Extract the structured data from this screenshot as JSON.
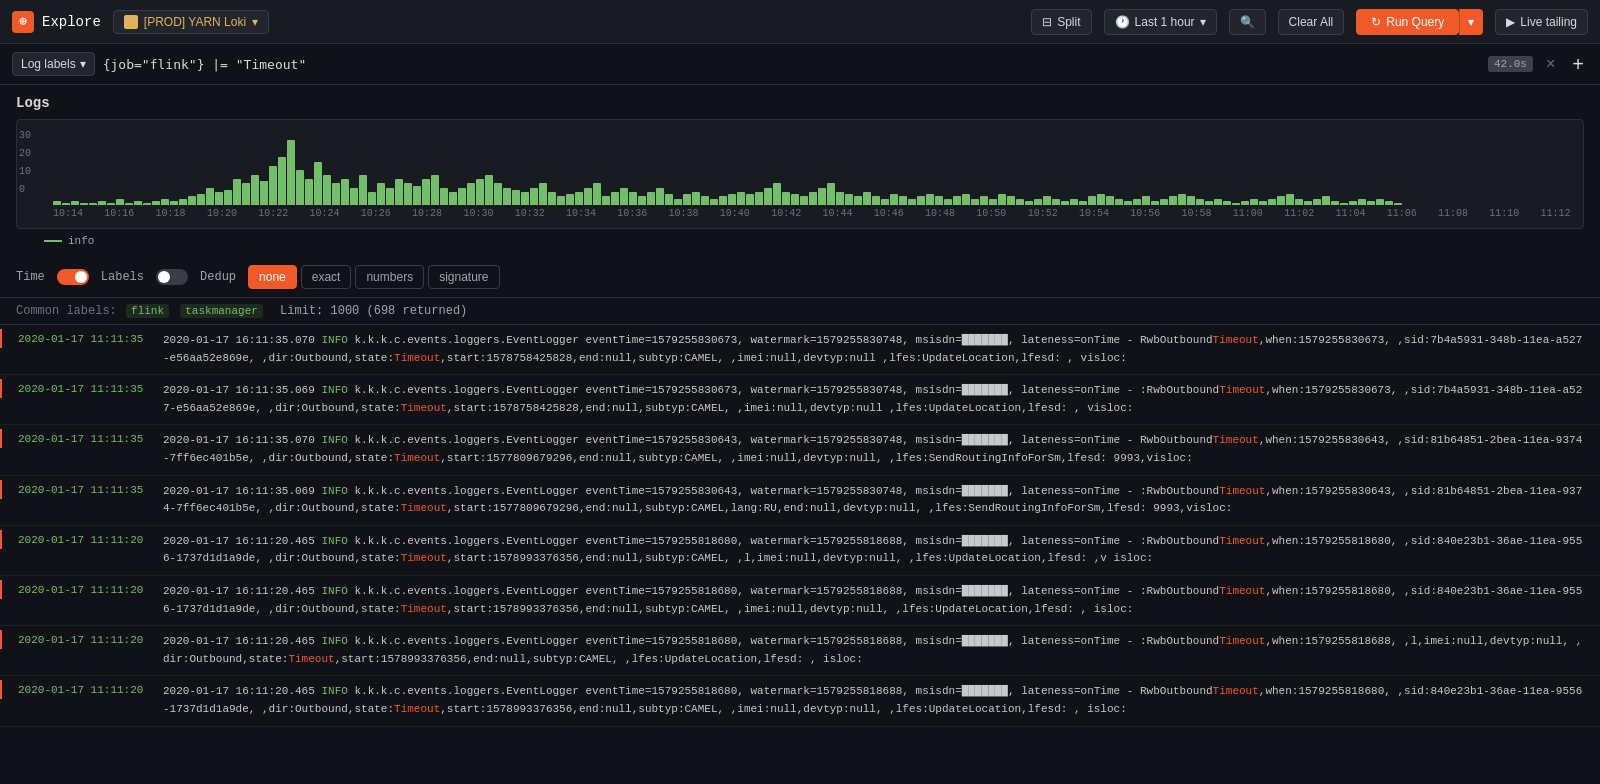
{
  "nav": {
    "logo_text": "Explore",
    "datasource": "[PROD] YARN Loki",
    "split_label": "Split",
    "time_range": "Last 1 hour",
    "clear_all_label": "Clear All",
    "run_query_label": "Run Query",
    "live_tailing_label": "Live tailing"
  },
  "query_bar": {
    "log_labels_btn": "Log labels",
    "query_text": "{job=\"flink\"} |= \"Timeout\"",
    "query_badge": "42.0s",
    "close_label": "×",
    "add_label": "+"
  },
  "logs_panel": {
    "title": "Logs",
    "y_labels": [
      "30",
      "20",
      "10",
      "0"
    ],
    "x_labels": [
      "10:14",
      "10:16",
      "10:18",
      "10:20",
      "10:22",
      "10:24",
      "10:26",
      "10:28",
      "10:30",
      "10:32",
      "10:34",
      "10:36",
      "10:38",
      "10:40",
      "10:42",
      "10:44",
      "10:46",
      "10:48",
      "10:50",
      "10:52",
      "10:54",
      "10:56",
      "10:58",
      "11:00",
      "11:02",
      "11:04",
      "11:06",
      "11:08",
      "11:10",
      "11:12"
    ],
    "bars": [
      2,
      1,
      2,
      1,
      1,
      2,
      1,
      3,
      1,
      2,
      1,
      2,
      3,
      2,
      3,
      4,
      5,
      8,
      6,
      7,
      12,
      10,
      14,
      11,
      18,
      22,
      30,
      16,
      12,
      20,
      14,
      10,
      12,
      8,
      14,
      6,
      10,
      8,
      12,
      10,
      9,
      12,
      14,
      8,
      6,
      8,
      10,
      12,
      14,
      10,
      8,
      7,
      6,
      8,
      10,
      6,
      4,
      5,
      6,
      8,
      10,
      4,
      6,
      8,
      6,
      4,
      6,
      8,
      5,
      3,
      5,
      6,
      4,
      3,
      4,
      5,
      6,
      5,
      6,
      8,
      10,
      6,
      5,
      4,
      6,
      8,
      10,
      6,
      5,
      4,
      6,
      4,
      3,
      5,
      4,
      3,
      4,
      5,
      4,
      3,
      4,
      5,
      3,
      4,
      3,
      5,
      4,
      3,
      2,
      3,
      4,
      3,
      2,
      3,
      2,
      4,
      5,
      4,
      3,
      2,
      3,
      4,
      2,
      3,
      4,
      5,
      4,
      3,
      2,
      3,
      2,
      1,
      2,
      3,
      2,
      3,
      4,
      5,
      3,
      2,
      3,
      4,
      2,
      1,
      2,
      3,
      2,
      3,
      2,
      1
    ],
    "legend_label": "info",
    "controls": {
      "time_label": "Time",
      "labels_label": "Labels",
      "dedup_label": "Dedup",
      "modes": [
        "none",
        "exact",
        "numbers",
        "signature"
      ],
      "active_mode": "none"
    },
    "common_labels": {
      "prefix": "Common labels:",
      "tags": [
        "flink",
        "taskmanager"
      ],
      "limit_text": "Limit: 1000 (698 returned)"
    },
    "log_rows": [
      {
        "timestamp": "2020-01-17 11:11:35",
        "content": "2020-01-17 16:11:35.070 INFO k.k.k.c.events.loggers.EventLogger eventTime=1579255830673, watermark=1579255830748, msisdn=███████, lateness=onTime -       RwbOutboundTimeout,when:1579255830673,       ,sid:7b4a5931-348b-11ea-a527-e56aa52e869e,       ,dir:Outbound,state:Timeout,start:1578758425828,end:null,subtyp:CAMEL,   ,imei:null,devtyp:null       ,lfes:UpdateLocation,lfesd:      , visloc:"
      },
      {
        "timestamp": "2020-01-17 11:11:35",
        "content": "2020-01-17 16:11:35.069 INFO k.k.k.c.events.loggers.EventLogger eventTime=1579255830673, watermark=1579255830748, msisdn=███████, lateness=onTime -    :RwbOutboundTimeout,when:1579255830673,      ,sid:7b4a5931-348b-11ea-a527-e56aa52e869e,       ,dir:Outbound,state:Timeout,start:1578758425828,end:null,subtyp:CAMEL,   ,imei:null,devtyp:null       ,lfes:UpdateLocation,lfesd:      , visloc:"
      },
      {
        "timestamp": "2020-01-17 11:11:35",
        "content": "2020-01-17 16:11:35.070 INFO k.k.k.c.events.loggers.EventLogger eventTime=1579255830643, watermark=1579255830748, msisdn=███████, lateness=onTime -    RwbOutboundTimeout,when:1579255830643,      ,sid:81b64851-2bea-11ea-9374-7ff6ec401b5e,       ,dir:Outbound,state:Timeout,start:1577809679296,end:null,subtyp:CAMEL,   ,imei:null,devtyp:null,       ,lfes:SendRoutingInfoForSm,lfesd:     9993,visloc:"
      },
      {
        "timestamp": "2020-01-17 11:11:35",
        "content": "2020-01-17 16:11:35.069 INFO k.k.k.c.events.loggers.EventLogger eventTime=1579255830643, watermark=1579255830748, msisdn=███████, lateness=onTime -    :RwbOutboundTimeout,when:1579255830643,      ,sid:81b64851-2bea-11ea-9374-7ff6ec401b5e,       ,dir:Outbound,state:Timeout,start:1577809679296,end:null,subtyp:CAMEL,lang:RU,end:null,devtyp:null,       ,lfes:SendRoutingInfoForSm,lfesd:     9993,visloc:"
      },
      {
        "timestamp": "2020-01-17 11:11:20",
        "content": "2020-01-17 16:11:20.465 INFO k.k.k.c.events.loggers.EventLogger eventTime=1579255818680, watermark=1579255818688, msisdn=███████, lateness=onTime -    :RwbOutboundTimeout,when:1579255818680,       ,sid:840e23b1-36ae-11ea-9556-1737d1d1a9de,       ,dir:Outbound,state:Timeout,start:1578993376356,end:null,subtyp:CAMEL,   ,l,imei:null,devtyp:null,       ,lfes:UpdateLocation,lfesd:      ,v isloc:"
      },
      {
        "timestamp": "2020-01-17 11:11:20",
        "content": "2020-01-17 16:11:20.465 INFO k.k.k.c.events.loggers.EventLogger eventTime=1579255818680, watermark=1579255818688, msisdn=███████, lateness=onTime -    :RwbOutboundTimeout,when:1579255818680,       ,sid:840e23b1-36ae-11ea-9556-1737d1d1a9de,       ,dir:Outbound,state:Timeout,start:1578993376356,end:null,subtyp:CAMEL,   ,imei:null,devtyp:null,       ,lfes:UpdateLocation,lfesd:      , isloc:"
      },
      {
        "timestamp": "2020-01-17 11:11:20",
        "content": "2020-01-17 16:11:20.465 INFO k.k.k.c.events.loggers.EventLogger eventTime=1579255818680, watermark=1579255818688, msisdn=███████, lateness=onTime -    :RwbOutboundTimeout,when:1579255818688,      ,l,imei:null,devtyp:null,       ,dir:Outbound,state:Timeout,start:1578993376356,end:null,subtyp:CAMEL,   ,lfes:UpdateLocation,lfesd:      , isloc:"
      },
      {
        "timestamp": "2020-01-17 11:11:20",
        "content": "2020-01-17 16:11:20.465 INFO k.k.k.c.events.loggers.EventLogger eventTime=1579255818680, watermark=1579255818688, msisdn=███████, lateness=onTime -    RwbOutboundTimeout,when:1579255818680,       ,sid:840e23b1-36ae-11ea-9556-1737d1d1a9de,       ,dir:Outbound,state:Timeout,start:1578993376356,end:null,subtyp:CAMEL,   ,imei:null,devtyp:null,       ,lfes:UpdateLocation,lfesd:      , isloc:"
      }
    ]
  }
}
